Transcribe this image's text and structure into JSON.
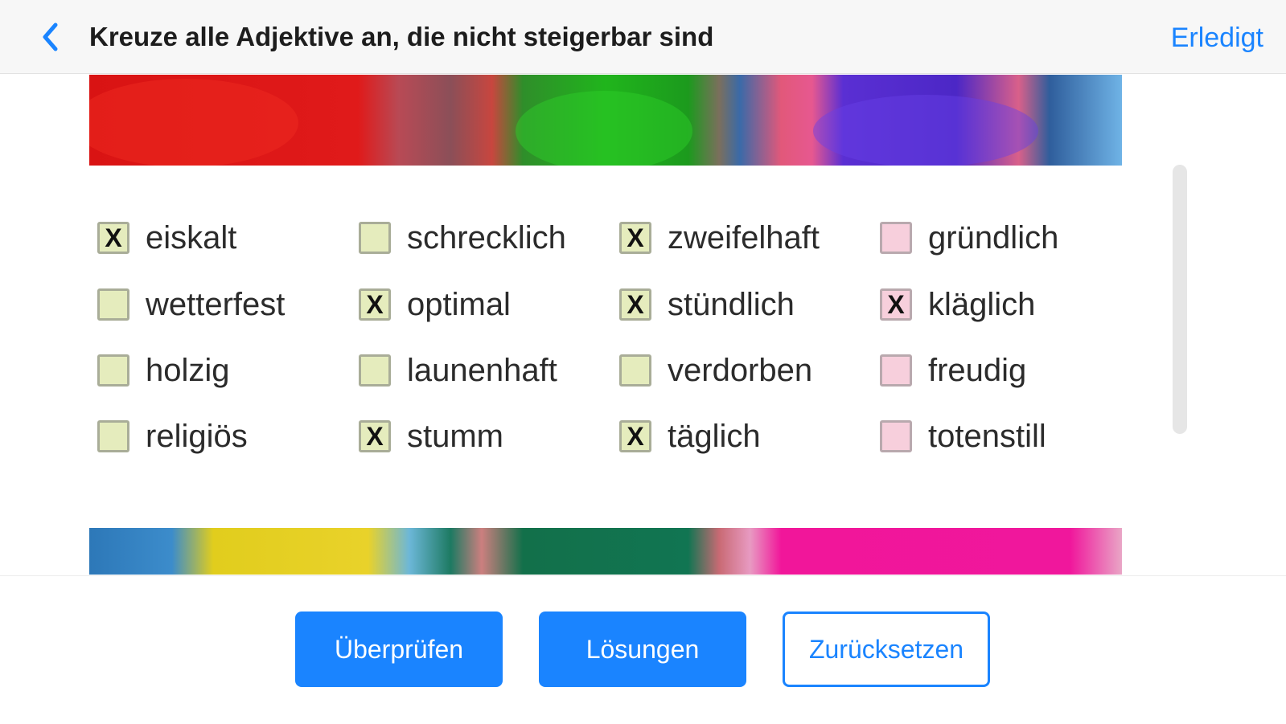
{
  "header": {
    "title": "Kreuze alle Adjektive an, die nicht steigerbar sind",
    "done_label": "Erledigt"
  },
  "colors": {
    "accent": "#1a84ff",
    "checkbox_green": "#e5ecbd",
    "checkbox_pink": "#f7cfdc"
  },
  "items": [
    {
      "label": "eiskalt",
      "checked": true,
      "mark": "X",
      "color": "green"
    },
    {
      "label": "schrecklich",
      "checked": false,
      "mark": "",
      "color": "green"
    },
    {
      "label": "zweifelhaft",
      "checked": true,
      "mark": "X",
      "color": "green"
    },
    {
      "label": "gründlich",
      "checked": false,
      "mark": "",
      "color": "pink"
    },
    {
      "label": "wetterfest",
      "checked": false,
      "mark": "",
      "color": "green"
    },
    {
      "label": "optimal",
      "checked": true,
      "mark": "X",
      "color": "green"
    },
    {
      "label": "stündlich",
      "checked": true,
      "mark": "X",
      "color": "green"
    },
    {
      "label": "kläglich",
      "checked": true,
      "mark": "X",
      "color": "pink"
    },
    {
      "label": "holzig",
      "checked": false,
      "mark": "",
      "color": "green"
    },
    {
      "label": "launenhaft",
      "checked": false,
      "mark": "",
      "color": "green"
    },
    {
      "label": "verdorben",
      "checked": false,
      "mark": "",
      "color": "green"
    },
    {
      "label": "freudig",
      "checked": false,
      "mark": "",
      "color": "pink"
    },
    {
      "label": "religiös",
      "checked": false,
      "mark": "",
      "color": "green"
    },
    {
      "label": "stumm",
      "checked": true,
      "mark": "X",
      "color": "green"
    },
    {
      "label": "täglich",
      "checked": true,
      "mark": "X",
      "color": "green"
    },
    {
      "label": "totenstill",
      "checked": false,
      "mark": "",
      "color": "pink"
    }
  ],
  "buttons": {
    "check_label": "Überprüfen",
    "solutions_label": "Lösungen",
    "reset_label": "Zurücksetzen"
  }
}
